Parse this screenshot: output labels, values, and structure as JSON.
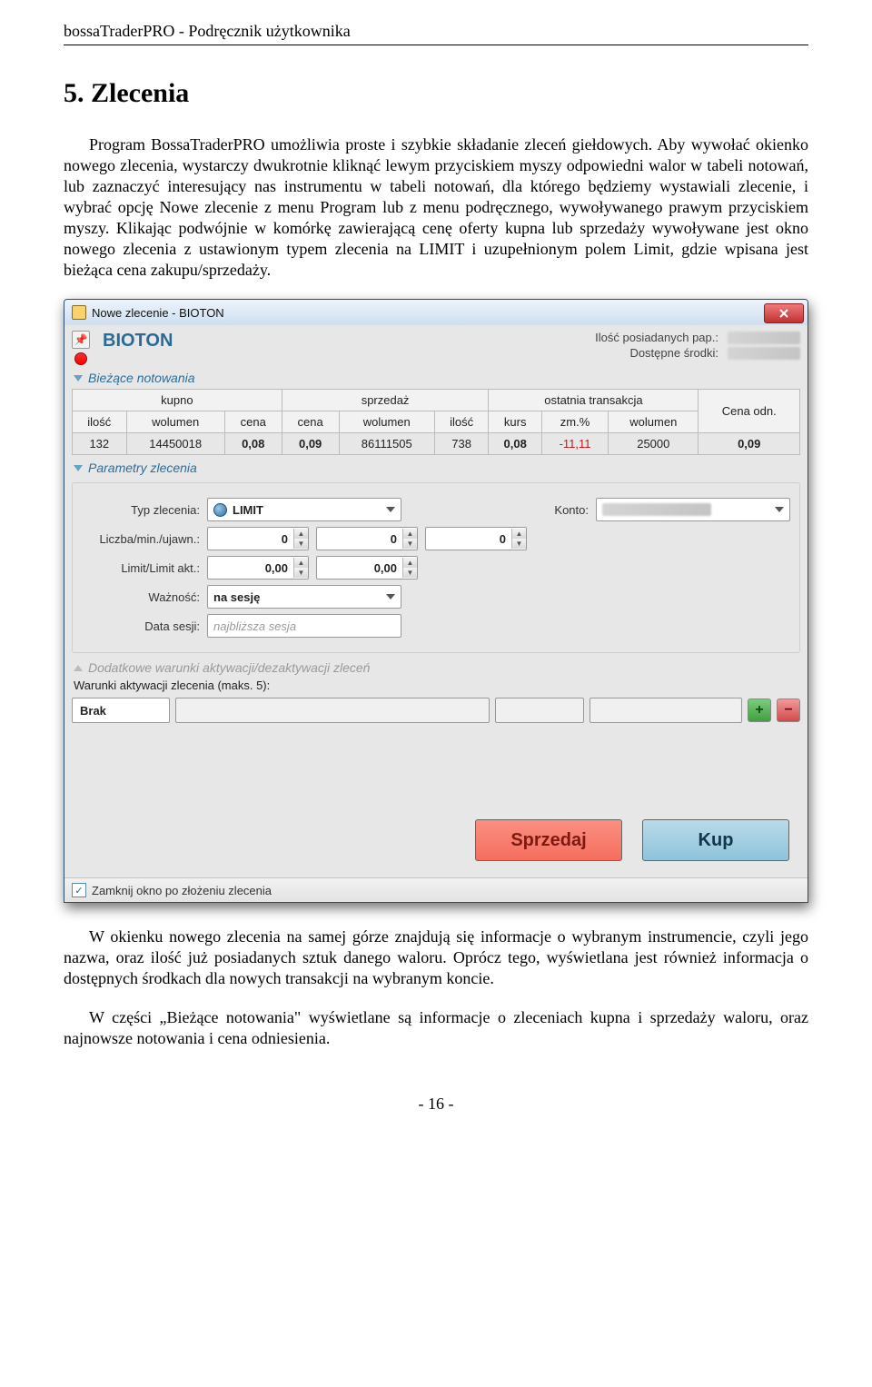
{
  "doc": {
    "header": "bossaTraderPRO - Podręcznik użytkownika",
    "section_title": "5. Zlecenia",
    "para1": "Program BossaTraderPRO umożliwia proste i szybkie składanie zleceń giełdowych. Aby wywołać okienko nowego zlecenia, wystarczy dwukrotnie kliknąć lewym przyciskiem myszy odpowiedni walor w tabeli notowań, lub zaznaczyć interesujący nas instrumentu w tabeli notowań, dla którego będziemy wystawiali zlecenie, i wybrać opcję Nowe zlecenie z menu Program lub z menu podręcznego, wywoływanego prawym przyciskiem myszy. Klikając podwójnie w komórkę zawierającą cenę oferty kupna lub sprzedaży wywoływane jest okno nowego zlecenia z ustawionym typem zlecenia na LIMIT i uzupełnionym polem Limit, gdzie wpisana jest bieżąca cena zakupu/sprzedaży.",
    "para2": "W okienku nowego zlecenia na samej górze znajdują się informacje o wybranym instrumencie, czyli jego nazwa, oraz ilość już posiadanych sztuk danego waloru. Oprócz tego, wyświetlana jest również informacja o dostępnych środkach dla nowych transakcji na wybranym koncie.",
    "para3": "W części „Bieżące notowania\" wyświetlane są informacje o zleceniach kupna i sprzedaży waloru, oraz najnowsze notowania i cena odniesienia.",
    "page_number": "- 16 -"
  },
  "win": {
    "title": "Nowe zlecenie - BIOTON",
    "stock": "BIOTON",
    "info_owned_label": "Ilość posiadanych pap.:",
    "info_funds_label": "Dostępne środki:",
    "section_quotes": "Bieżące notowania",
    "section_params": "Parametry zlecenia",
    "section_extra": "Dodatkowe warunki aktywacji/dezaktywacji zleceń",
    "extra_label": "Warunki aktywacji zlecenia (maks. 5):",
    "cond_brak": "Brak",
    "table": {
      "grp_buy": "kupno",
      "grp_sell": "sprzedaż",
      "grp_last": "ostatnia transakcja",
      "col_ilosc": "ilość",
      "col_wolumen": "wolumen",
      "col_cena": "cena",
      "col_kurs": "kurs",
      "col_zm": "zm.%",
      "col_cena_odn": "Cena odn.",
      "r": {
        "buy_ilosc": "132",
        "buy_wol": "14450018",
        "buy_cena": "0,08",
        "sell_cena": "0,09",
        "sell_wol": "86111505",
        "sell_ilosc": "738",
        "last_kurs": "0,08",
        "last_zm": "-11,11",
        "last_wol": "25000",
        "cena_odn": "0,09"
      }
    },
    "params": {
      "typ_label": "Typ zlecenia:",
      "typ_value": "LIMIT",
      "konto_label": "Konto:",
      "liczba_label": "Liczba/min./ujawn.:",
      "liczba_v1": "0",
      "liczba_v2": "0",
      "liczba_v3": "0",
      "limit_label": "Limit/Limit akt.:",
      "limit_v1": "0,00",
      "limit_v2": "0,00",
      "waznosc_label": "Ważność:",
      "waznosc_value": "na sesję",
      "data_label": "Data sesji:",
      "data_value": "najbliższa sesja"
    },
    "btn_sell": "Sprzedaj",
    "btn_buy": "Kup",
    "close_checkbox": "Zamknij okno po złożeniu zlecenia"
  }
}
